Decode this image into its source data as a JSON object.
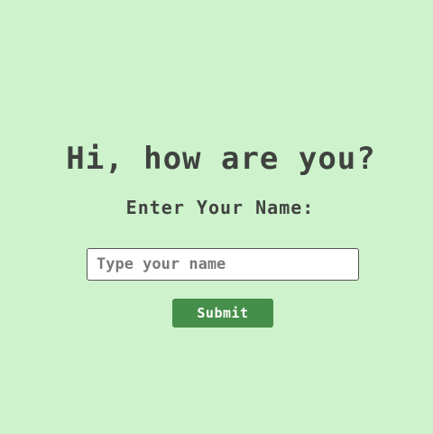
{
  "greeting": {
    "heading": "Hi, how are you?",
    "prompt_label": "Enter Your Name:"
  },
  "form": {
    "name_input_value": "",
    "name_input_placeholder": "Type your name",
    "submit_label": "Submit"
  },
  "colors": {
    "background": "#cdf2cc",
    "text": "#3f423f",
    "button_background": "#468f4a",
    "button_text": "#ffffff"
  }
}
